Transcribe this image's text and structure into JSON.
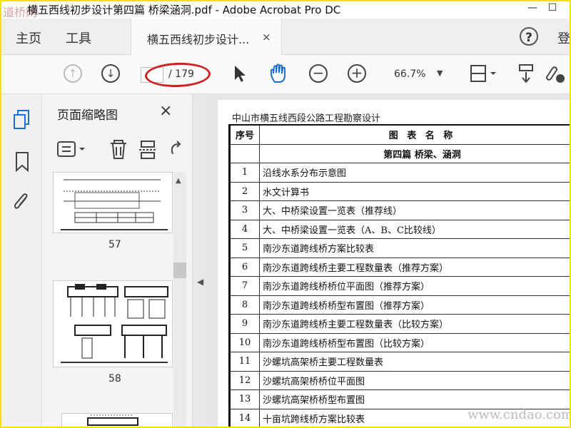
{
  "window": {
    "title": "横五西线初步设计第四篇 桥梁涵洞.pdf - Adobe Acrobat Pro DC",
    "watermark_tl": "道桥网",
    "minimize": "—",
    "maximize": "☐"
  },
  "menubar": {
    "home": "主页",
    "tools": "工具",
    "tab_label": "横五西线初步设计...",
    "tab_close": "×",
    "help": "?",
    "user_partial": "登"
  },
  "toolbar": {
    "page_input": "",
    "page_total": "/ 179",
    "zoom": "66.7%"
  },
  "thumb_panel": {
    "title": "页面缩略图",
    "close": "×",
    "pages": [
      "57",
      "58"
    ]
  },
  "document": {
    "header": "中山市横五线西段公路工程勘察设计",
    "table_header": {
      "col1": "序号",
      "col2": "图 表 名 称"
    },
    "section_title": "第四篇 桥梁、涵洞",
    "rows": [
      {
        "no": "1",
        "name": "沿线水系分布示意图"
      },
      {
        "no": "2",
        "name": "水文计算书"
      },
      {
        "no": "3",
        "name": "大、中桥梁设置一览表（推荐线）"
      },
      {
        "no": "4",
        "name": "大、中桥梁设置一览表（A、B、C比较线）"
      },
      {
        "no": "5",
        "name": "南沙东道跨线桥方案比较表"
      },
      {
        "no": "6",
        "name": "南沙东道跨线桥主要工程数量表（推荐方案）"
      },
      {
        "no": "7",
        "name": "南沙东道跨线桥桥位平面图（推荐方案）"
      },
      {
        "no": "8",
        "name": "南沙东道跨线桥桥型布置图（推荐方案）"
      },
      {
        "no": "9",
        "name": "南沙东道跨线桥主要工程数量表（比较方案）"
      },
      {
        "no": "10",
        "name": "南沙东道跨线桥桥型布置图（比较方案）"
      },
      {
        "no": "11",
        "name": "沙螺坑高架桥主要工程数量表"
      },
      {
        "no": "12",
        "name": "沙螺坑高架桥桥位平面图"
      },
      {
        "no": "13",
        "name": "沙螺坑高架桥桥型布置图"
      },
      {
        "no": "14",
        "name": "十亩坑跨线桥方案比较表"
      }
    ],
    "watermark_br": "www.cndao.com"
  }
}
